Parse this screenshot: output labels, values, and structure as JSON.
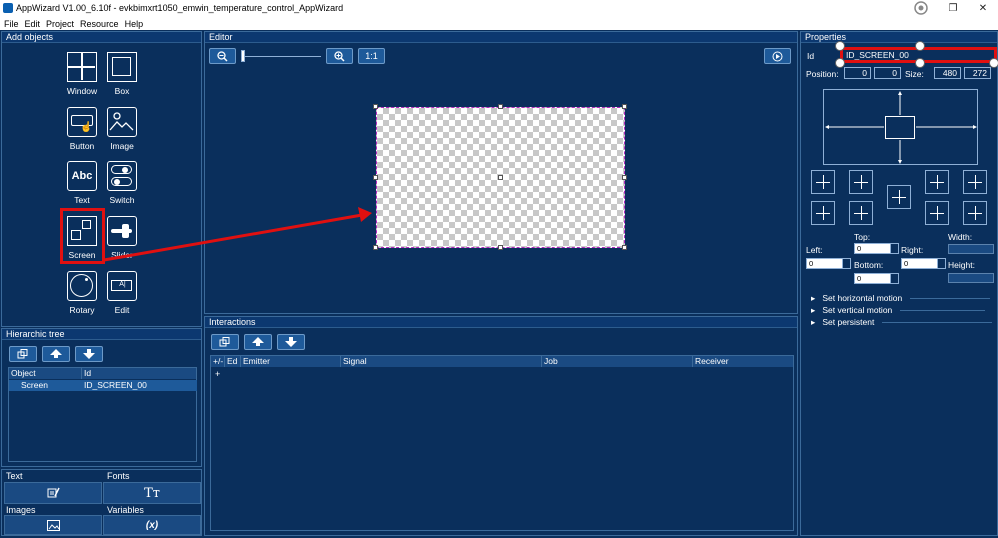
{
  "window": {
    "title": "AppWizard V1.00_6.10f - evkbimxrt1050_emwin_temperature_control_AppWizard"
  },
  "menu": [
    "File",
    "Edit",
    "Project",
    "Resource",
    "Help"
  ],
  "add_objects": {
    "title": "Add objects",
    "items": [
      {
        "label": "Window",
        "icon": "window-icon"
      },
      {
        "label": "Box",
        "icon": "box-icon"
      },
      {
        "label": "Button",
        "icon": "button-icon"
      },
      {
        "label": "Image",
        "icon": "image-icon"
      },
      {
        "label": "Text",
        "icon": "text-icon",
        "glyph": "Abc"
      },
      {
        "label": "Switch",
        "icon": "switch-icon"
      },
      {
        "label": "Screen",
        "icon": "screen-icon",
        "highlighted": true
      },
      {
        "label": "Slider",
        "icon": "slider-icon"
      },
      {
        "label": "Rotary",
        "icon": "rotary-icon"
      },
      {
        "label": "Edit",
        "icon": "edit-icon",
        "glyph": "A|"
      }
    ]
  },
  "hierarchic_tree": {
    "title": "Hierarchic tree",
    "columns": [
      "Object",
      "Id"
    ],
    "rows": [
      {
        "object": "Screen",
        "id": "ID_SCREEN_00"
      }
    ]
  },
  "resources": {
    "text": "Text",
    "fonts": "Fonts",
    "images": "Images",
    "variables": "Variables",
    "variables_glyph": "(x)",
    "fonts_glyph": "Tт"
  },
  "editor": {
    "title": "Editor",
    "zoom_label": "1:1"
  },
  "interactions": {
    "title": "Interactions",
    "columns": [
      "+/-",
      "Ed",
      "Emitter",
      "Signal",
      "Job",
      "Receiver"
    ],
    "add_symbol": "+"
  },
  "properties": {
    "title": "Properties",
    "id_label": "Id",
    "id_value": "ID_SCREEN_00",
    "position_label": "Position:",
    "pos_x": "0",
    "pos_y": "0",
    "size_label": "Size:",
    "size_w": "480",
    "size_h": "272",
    "top_label": "Top:",
    "width_label": "Width:",
    "left_label": "Left:",
    "right_label": "Right:",
    "bottom_label": "Bottom:",
    "height_label": "Height:",
    "top_value": "0",
    "left_value": "0",
    "bottom_value": "0",
    "bottom2_value": "0",
    "motion": [
      "Set horizontal motion",
      "Set vertical motion",
      "Set persistent"
    ]
  },
  "colors": {
    "background": "#0a2f5c",
    "highlight": "#e01010",
    "selection": "#b227c0"
  }
}
